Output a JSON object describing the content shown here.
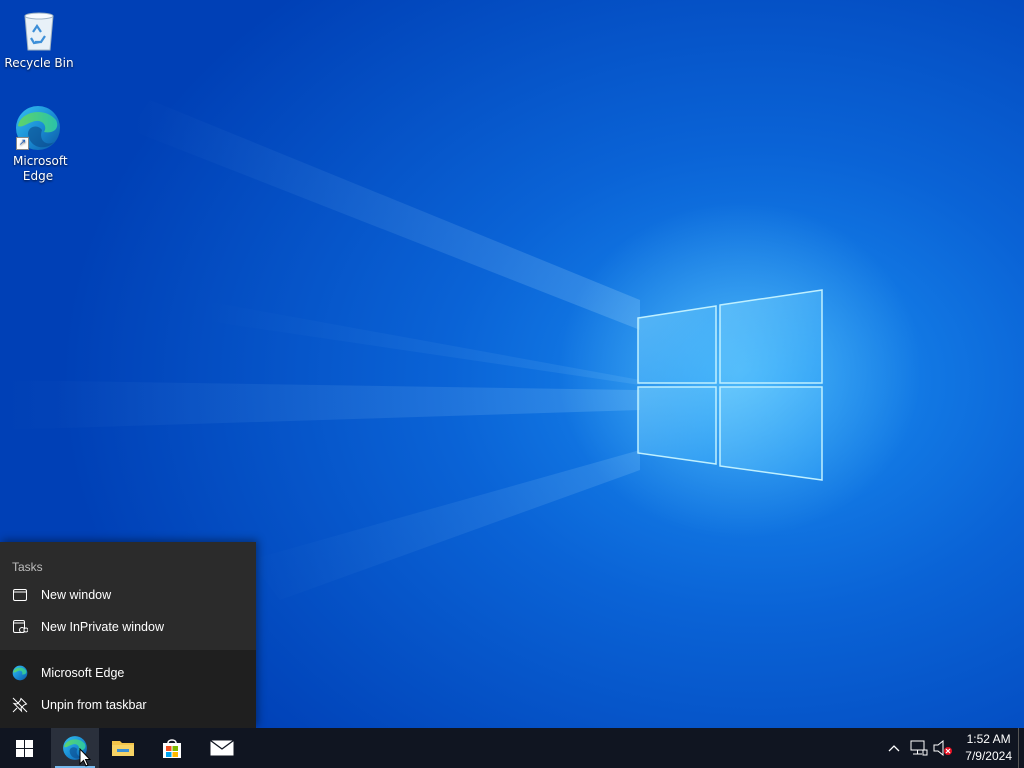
{
  "desktop": {
    "icons": [
      {
        "label": "Recycle Bin",
        "icon": "recycle-bin-icon"
      },
      {
        "label": "Microsoft Edge",
        "icon": "edge-icon"
      }
    ]
  },
  "jumplist": {
    "heading": "Tasks",
    "tasks": [
      {
        "label": "New window",
        "icon": "window-icon"
      },
      {
        "label": "New InPrivate window",
        "icon": "inprivate-window-icon"
      }
    ],
    "app": {
      "label": "Microsoft Edge",
      "icon": "edge-icon"
    },
    "unpin": {
      "label": "Unpin from taskbar",
      "icon": "unpin-icon"
    }
  },
  "taskbar": {
    "apps": [
      {
        "name": "start",
        "icon": "windows-logo-icon"
      },
      {
        "name": "Microsoft Edge",
        "icon": "edge-icon",
        "active": true
      },
      {
        "name": "File Explorer",
        "icon": "folder-icon"
      },
      {
        "name": "Microsoft Store",
        "icon": "store-icon"
      },
      {
        "name": "Mail",
        "icon": "mail-icon"
      }
    ],
    "tray": {
      "chevron": "^",
      "network_icon": "network-disconnected-icon",
      "volume_icon": "volume-muted-icon"
    },
    "clock": {
      "time": "1:52 AM",
      "date": "7/9/2024"
    }
  },
  "colors": {
    "taskbar_bg": "#101521",
    "jumplist_bg": "#2b2b2b",
    "accent": "#76b9ed"
  }
}
